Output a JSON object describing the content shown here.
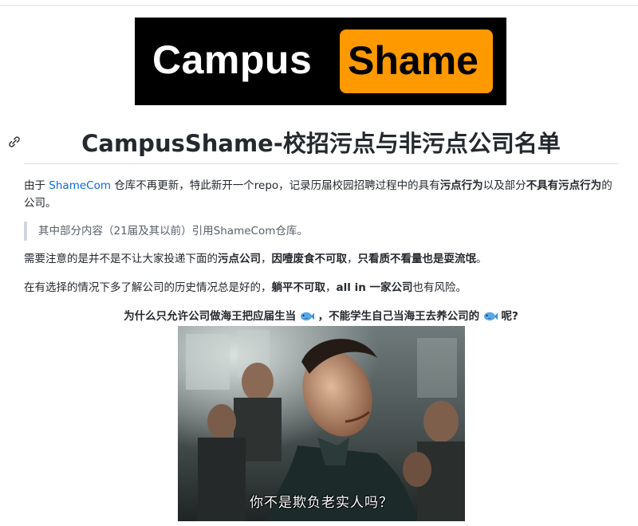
{
  "logo": {
    "left_text": "Campus",
    "right_text": "Shame",
    "accent": "#ff9900"
  },
  "heading": {
    "title": "CampusShame-校招污点与非污点公司名单"
  },
  "intro": {
    "t1": "由于 ",
    "link": "ShameCom",
    "t2": " 仓库不再更新，特此新开一个repo，记录历届校园招聘过程中的具有",
    "b1": "污点行为",
    "t3": "以及部分",
    "b2": "不具有污点行为",
    "t4": "的公司。"
  },
  "quote": {
    "text": "其中部分内容（21届及其以前）引用ShameCom仓库。"
  },
  "note": {
    "t1": "需要注意的是并不是不让大家投递下面的",
    "b1": "污点公司",
    "t2": "，",
    "b2": "因噎废食不可取",
    "t3": "，",
    "b3": "只看质不看量也是耍流氓",
    "t4": "。"
  },
  "advice": {
    "t1": "在有选择的情况下多了解公司的历史情况总是好的，",
    "b1": "躺平不可取",
    "t2": "，",
    "b2": "all in 一家公司",
    "t3": "也有风险。"
  },
  "caption": {
    "part1": "为什么只允许公司做海王把应届生当",
    "part2": "，不能学生自己当海王去养公司的",
    "part3": "呢?"
  },
  "meme": {
    "subtitle": "你不是欺负老实人吗？"
  },
  "icons": {
    "anchor": "link-icon",
    "fish": "fish-emoji"
  }
}
